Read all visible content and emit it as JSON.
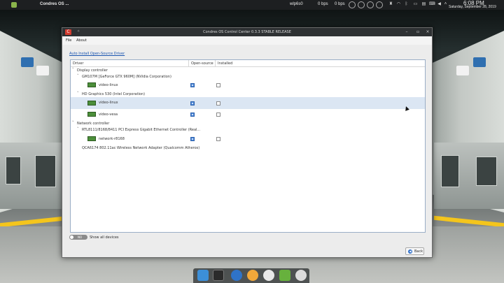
{
  "topbar": {
    "app_title": "Condres OS ...",
    "wifi": "wlp6s0",
    "net_down": "0 bps",
    "net_up": "0 bps",
    "time": "6:08 PM",
    "date": "Saturday, September 28, 2019"
  },
  "window": {
    "title": "Condres OS Control Center 0.3.3 STABLE RELEASE",
    "menu": [
      "File",
      "About"
    ],
    "auto_install_link": "Auto Install Open-Source Driver",
    "columns": [
      "Driver",
      "Open-source",
      "Installed"
    ],
    "tree": [
      {
        "kind": "category",
        "label": "Display controller"
      },
      {
        "kind": "device",
        "label": "GM107M [GeForce GTX 960M] (NVidia Corporation)"
      },
      {
        "kind": "driver",
        "label": "video-linux",
        "open_source": true,
        "installed": false
      },
      {
        "kind": "device",
        "label": "HD Graphics 530 (Intel Corporation)"
      },
      {
        "kind": "driver",
        "label": "video-linux",
        "open_source": true,
        "installed": false,
        "selected": true
      },
      {
        "kind": "driver",
        "label": "video-vesa",
        "open_source": true,
        "installed": false
      },
      {
        "kind": "category",
        "label": "Network controller"
      },
      {
        "kind": "device",
        "label": "RTL8111/8168/8411 PCI Express Gigabit Ethernet Controller (Real..."
      },
      {
        "kind": "driver",
        "label": "network-r8168",
        "open_source": true,
        "installed": false
      },
      {
        "kind": "device",
        "label": "QCA6174 802.11ac Wireless Network Adapter (Qualcomm Atheros)"
      }
    ],
    "toggle_state": "NO",
    "toggle_label": "Show all devices",
    "back_label": "Back"
  },
  "colors": {
    "accent": "#4a86d8",
    "link": "#1a55b0",
    "selection": "#dbe6f3",
    "titlebar": "#2e3133"
  }
}
